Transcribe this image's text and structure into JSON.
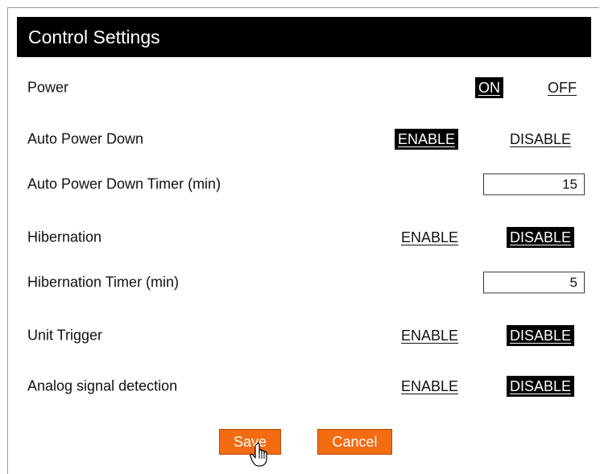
{
  "panel": {
    "title": "Control Settings"
  },
  "settings": {
    "power": {
      "label": "Power",
      "on_label": "ON",
      "off_label": "OFF",
      "selected": "ON"
    },
    "auto_power_down": {
      "label": "Auto Power Down",
      "enable_label": "ENABLE",
      "disable_label": "DISABLE",
      "selected": "ENABLE"
    },
    "auto_power_down_timer": {
      "label": "Auto Power Down Timer (min)",
      "value": "15"
    },
    "hibernation": {
      "label": "Hibernation",
      "enable_label": "ENABLE",
      "disable_label": "DISABLE",
      "selected": "DISABLE"
    },
    "hibernation_timer": {
      "label": "Hibernation Timer (min)",
      "value": "5"
    },
    "unit_trigger": {
      "label": "Unit Trigger",
      "enable_label": "ENABLE",
      "disable_label": "DISABLE",
      "selected": "DISABLE"
    },
    "analog_signal_detection": {
      "label": "Analog signal detection",
      "enable_label": "ENABLE",
      "disable_label": "DISABLE",
      "selected": "DISABLE"
    }
  },
  "actions": {
    "save_label": "Save",
    "cancel_label": "Cancel"
  },
  "colors": {
    "header_bg": "#000000",
    "header_text": "#ffffff",
    "selected_bg": "#000000",
    "button_bg": "#f46b12",
    "button_text": "#ffffff"
  },
  "icons": {
    "cursor": "hand-pointer-icon"
  }
}
